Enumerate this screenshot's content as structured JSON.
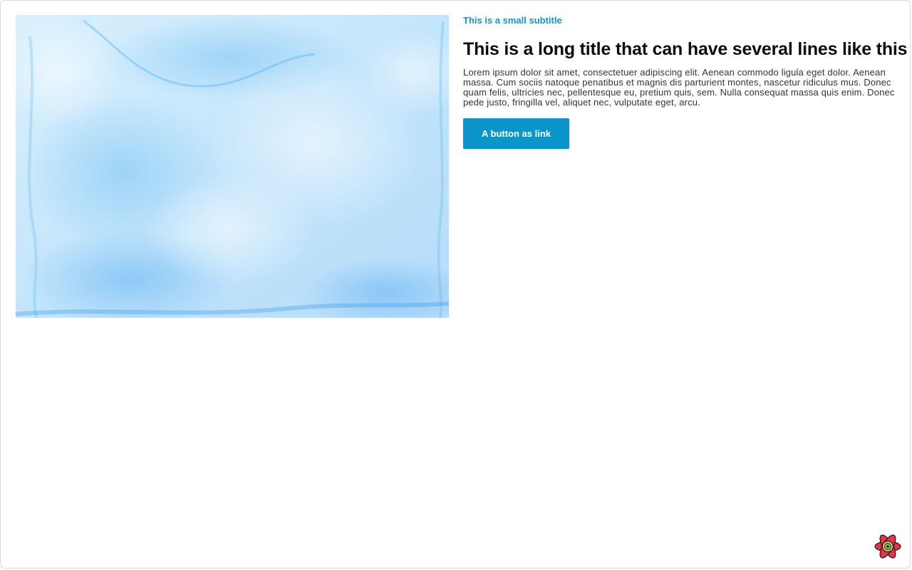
{
  "card": {
    "subtitle": "This is a small subtitle",
    "title": "This is a long title that can have several lines like this",
    "description": "Lorem ipsum dolor sit amet, consectetuer adipiscing elit. Aenean commodo ligula eget dolor. Aenean massa. Cum sociis natoque penatibus et magnis dis parturient montes, nascetur ridiculus mus. Donec quam felis, ultricies nec, pellentesque eu, pretium quis, sem. Nulla consequat massa quis enim. Donec pede justo, fringilla vel, aliquet nec, vulputate eget, arcu.",
    "button_label": "A button as link"
  },
  "icons": {
    "corner_logo": "atom-flower-icon"
  },
  "colors": {
    "accent": "#0b95c9",
    "subtitle": "#1b8fc2",
    "title": "#0d0d0d",
    "image_base": "#cdeafc",
    "logo_red": "#e2344a",
    "logo_ring": "#ffd34d"
  }
}
